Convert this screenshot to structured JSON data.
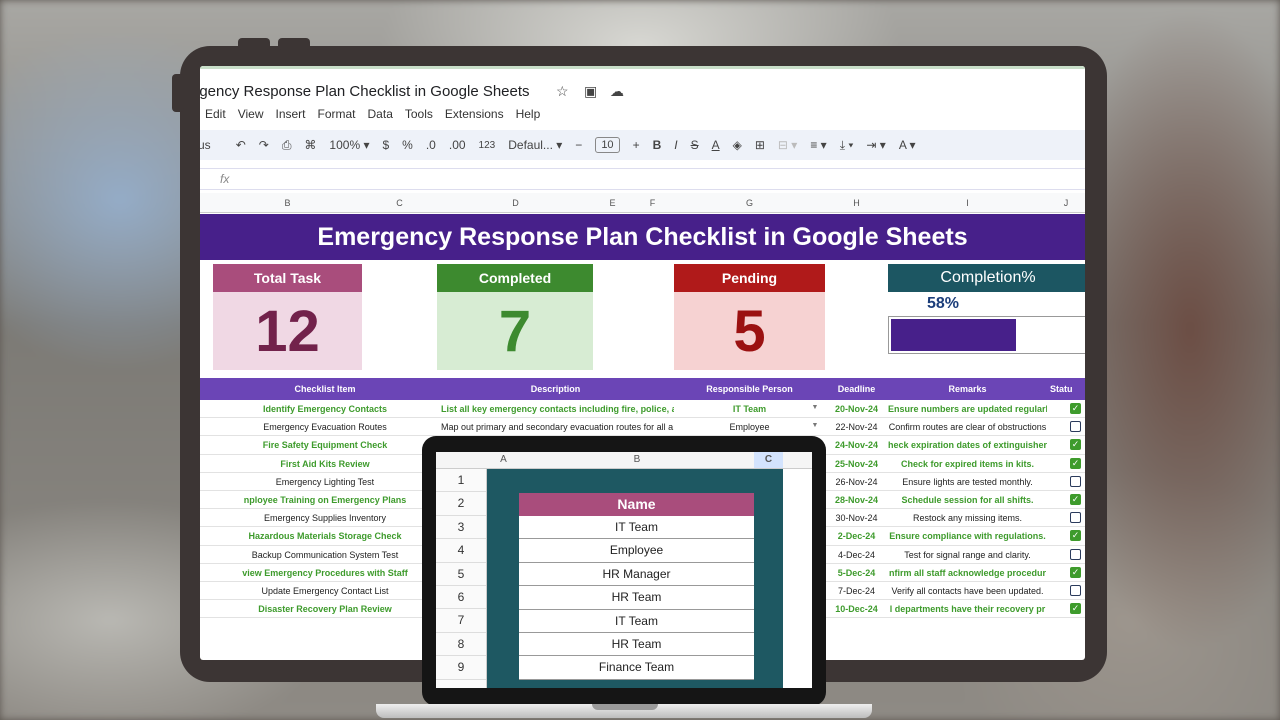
{
  "doc": {
    "title": "ergency Response Plan Checklist in Google Sheets",
    "menus": [
      "Edit",
      "View",
      "Insert",
      "Format",
      "Data",
      "Tools",
      "Extensions",
      "Help"
    ]
  },
  "toolbar": {
    "search_label": "us",
    "zoom": "100%",
    "currency": "$",
    "percent": "%",
    "dec_decrease": ".0",
    "dec_increase": ".00",
    "number_format": "123",
    "font": "Defaul...",
    "font_size": "10"
  },
  "formula_bar": {
    "fx": "fx"
  },
  "columns": [
    "B",
    "C",
    "D",
    "E",
    "F",
    "G",
    "H",
    "I",
    "J"
  ],
  "sheet_title": "Emergency Response Plan Checklist in Google Sheets",
  "kpis": {
    "total": {
      "label": "Total Task",
      "value": "12"
    },
    "completed": {
      "label": "Completed",
      "value": "7"
    },
    "pending": {
      "label": "Pending",
      "value": "5"
    },
    "completion": {
      "label": "Completion%",
      "value": "58%",
      "fraction": 0.58
    }
  },
  "table": {
    "headers": {
      "item": "Checklist Item",
      "description": "Description",
      "person": "Responsible Person",
      "deadline": "Deadline",
      "remarks": "Remarks",
      "status": "Statu"
    },
    "rows": [
      {
        "item": "Identify Emergency Contacts",
        "description": "List all key emergency contacts including fire, police, a",
        "person": "IT Team",
        "deadline": "20-Nov-24",
        "remarks": "Ensure numbers are updated regularly",
        "done": true
      },
      {
        "item": "Emergency Evacuation Routes",
        "description": "Map out primary and secondary evacuation routes for all a",
        "person": "Employee",
        "deadline": "22-Nov-24",
        "remarks": "Confirm routes are clear of obstructions",
        "done": false
      },
      {
        "item": "Fire Safety Equipment Check",
        "description": "",
        "person": "",
        "deadline": "24-Nov-24",
        "remarks": "heck expiration dates of extinguisher",
        "done": true
      },
      {
        "item": "First Aid Kits Review",
        "description": "",
        "person": "",
        "deadline": "25-Nov-24",
        "remarks": "Check for expired items in kits.",
        "done": true
      },
      {
        "item": "Emergency Lighting Test",
        "description": "",
        "person": "",
        "deadline": "26-Nov-24",
        "remarks": "Ensure lights are tested monthly.",
        "done": false
      },
      {
        "item": "nployee Training on Emergency Plans",
        "description": "",
        "person": "",
        "deadline": "28-Nov-24",
        "remarks": "Schedule session for all shifts.",
        "done": true
      },
      {
        "item": "Emergency Supplies Inventory",
        "description": "",
        "person": "",
        "deadline": "30-Nov-24",
        "remarks": "Restock any missing items.",
        "done": false
      },
      {
        "item": "Hazardous Materials Storage Check",
        "description": "",
        "person": "",
        "deadline": "2-Dec-24",
        "remarks": "Ensure compliance with regulations.",
        "done": true
      },
      {
        "item": "Backup Communication System Test",
        "description": "",
        "person": "",
        "deadline": "4-Dec-24",
        "remarks": "Test for signal range and clarity.",
        "done": false
      },
      {
        "item": "view Emergency Procedures with Staff",
        "description": "",
        "person": "",
        "deadline": "5-Dec-24",
        "remarks": "nfirm all staff acknowledge procedur",
        "done": true
      },
      {
        "item": "Update Emergency Contact List",
        "description": "",
        "person": "",
        "deadline": "7-Dec-24",
        "remarks": "Verify all contacts have been updated.",
        "done": false
      },
      {
        "item": "Disaster Recovery Plan Review",
        "description": "",
        "person": "",
        "deadline": "10-Dec-24",
        "remarks": "l departments have their recovery pr",
        "done": true
      }
    ]
  },
  "laptop_sheet": {
    "columns": [
      "A",
      "B",
      "C"
    ],
    "row_numbers": [
      "1",
      "2",
      "3",
      "4",
      "5",
      "6",
      "7",
      "8",
      "9"
    ],
    "header": "Name",
    "names": [
      "IT Team",
      "Employee",
      "HR Manager",
      "HR Team",
      "IT Team",
      "HR Team",
      "Finance Team"
    ]
  },
  "colors": {
    "title_bar": "#47208a",
    "total": "#a94d7c",
    "completed": "#3d8a2f",
    "pending": "#b01a1a",
    "completion": "#1c5662",
    "done_check": "#3e9b2c"
  }
}
